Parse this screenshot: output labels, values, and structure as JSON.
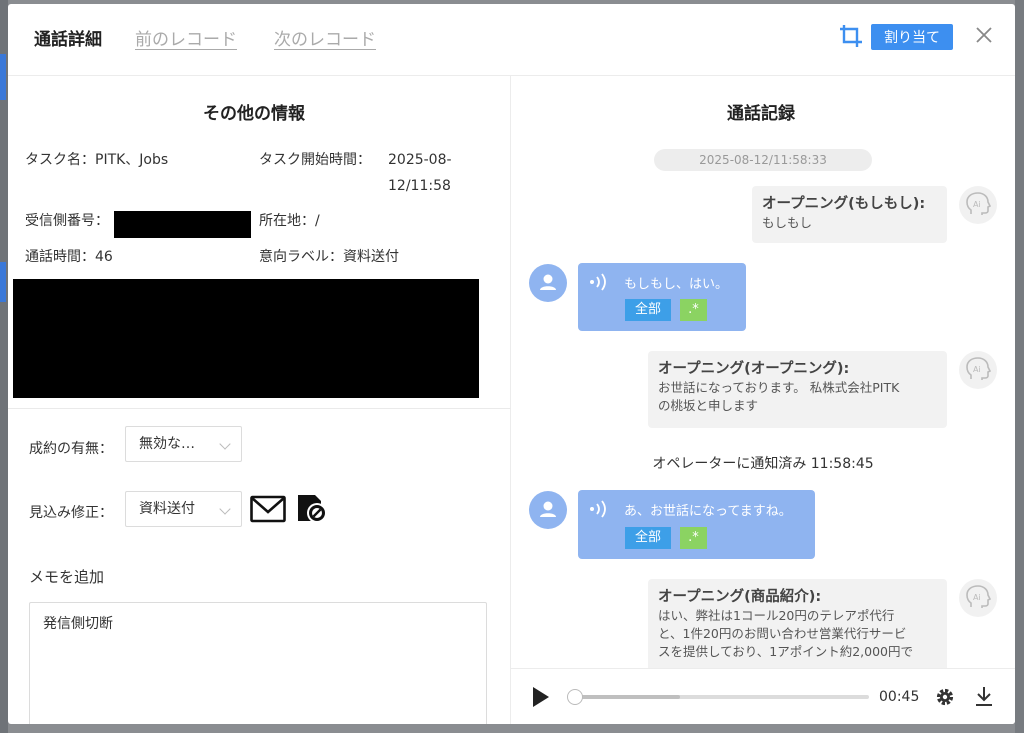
{
  "header": {
    "title": "通話詳細",
    "prev_label": "前のレコード",
    "next_label": "次のレコード",
    "assign_label": "割り当て"
  },
  "info": {
    "section_title": "その他の情報",
    "task_name": "タスク名：PITK、Jobs",
    "task_start_label": "タスク開始時間：",
    "task_start_value_1": "2025-08-",
    "task_start_value_2": "12/11:58",
    "receiver_label": "受信側番号：",
    "location": "所在地：/",
    "duration": "通話時間：46",
    "intent": "意向ラベル：資料送付"
  },
  "form": {
    "contract_label": "成約の有無：",
    "contract_value": "無効な…",
    "prospect_label": "見込み修正：",
    "prospect_value": "資料送付",
    "memo_label": "メモを追加",
    "memo_value": "発信側切断"
  },
  "record": {
    "section_title": "通話記録",
    "date": "2025-08-12/11:58:33",
    "messages": [
      {
        "head": "オープニング(もしもし):",
        "body": "もしもし"
      },
      {
        "text": "もしもし、はい。",
        "tag_all": "全部",
        "tag_star": ".*"
      },
      {
        "head": "オープニング(オープニング):",
        "body1": "お世話になっております。 私株式会社PITK",
        "body2": "の桃坂と申します"
      },
      {
        "notify": "オペレーターに通知済み 11:58:45"
      },
      {
        "text": "あ、お世話になってますね。",
        "tag_all": "全部",
        "tag_star": ".*"
      },
      {
        "head": "オープニング(商品紹介):",
        "body1": "はい、弊社は1コール20円のテレアポ代行",
        "body2": "と、1件20円のお問い合わせ営業代行サービ",
        "body3": "スを提供しており、1アポイント約2,000円で"
      }
    ]
  },
  "player": {
    "time": "00:45",
    "progress": 0.36
  },
  "colors": {
    "accent": "#3d8ff0",
    "user_bubble": "#8fb4f0",
    "tag_all": "#3d9fe8",
    "tag_star": "#8bd362"
  }
}
